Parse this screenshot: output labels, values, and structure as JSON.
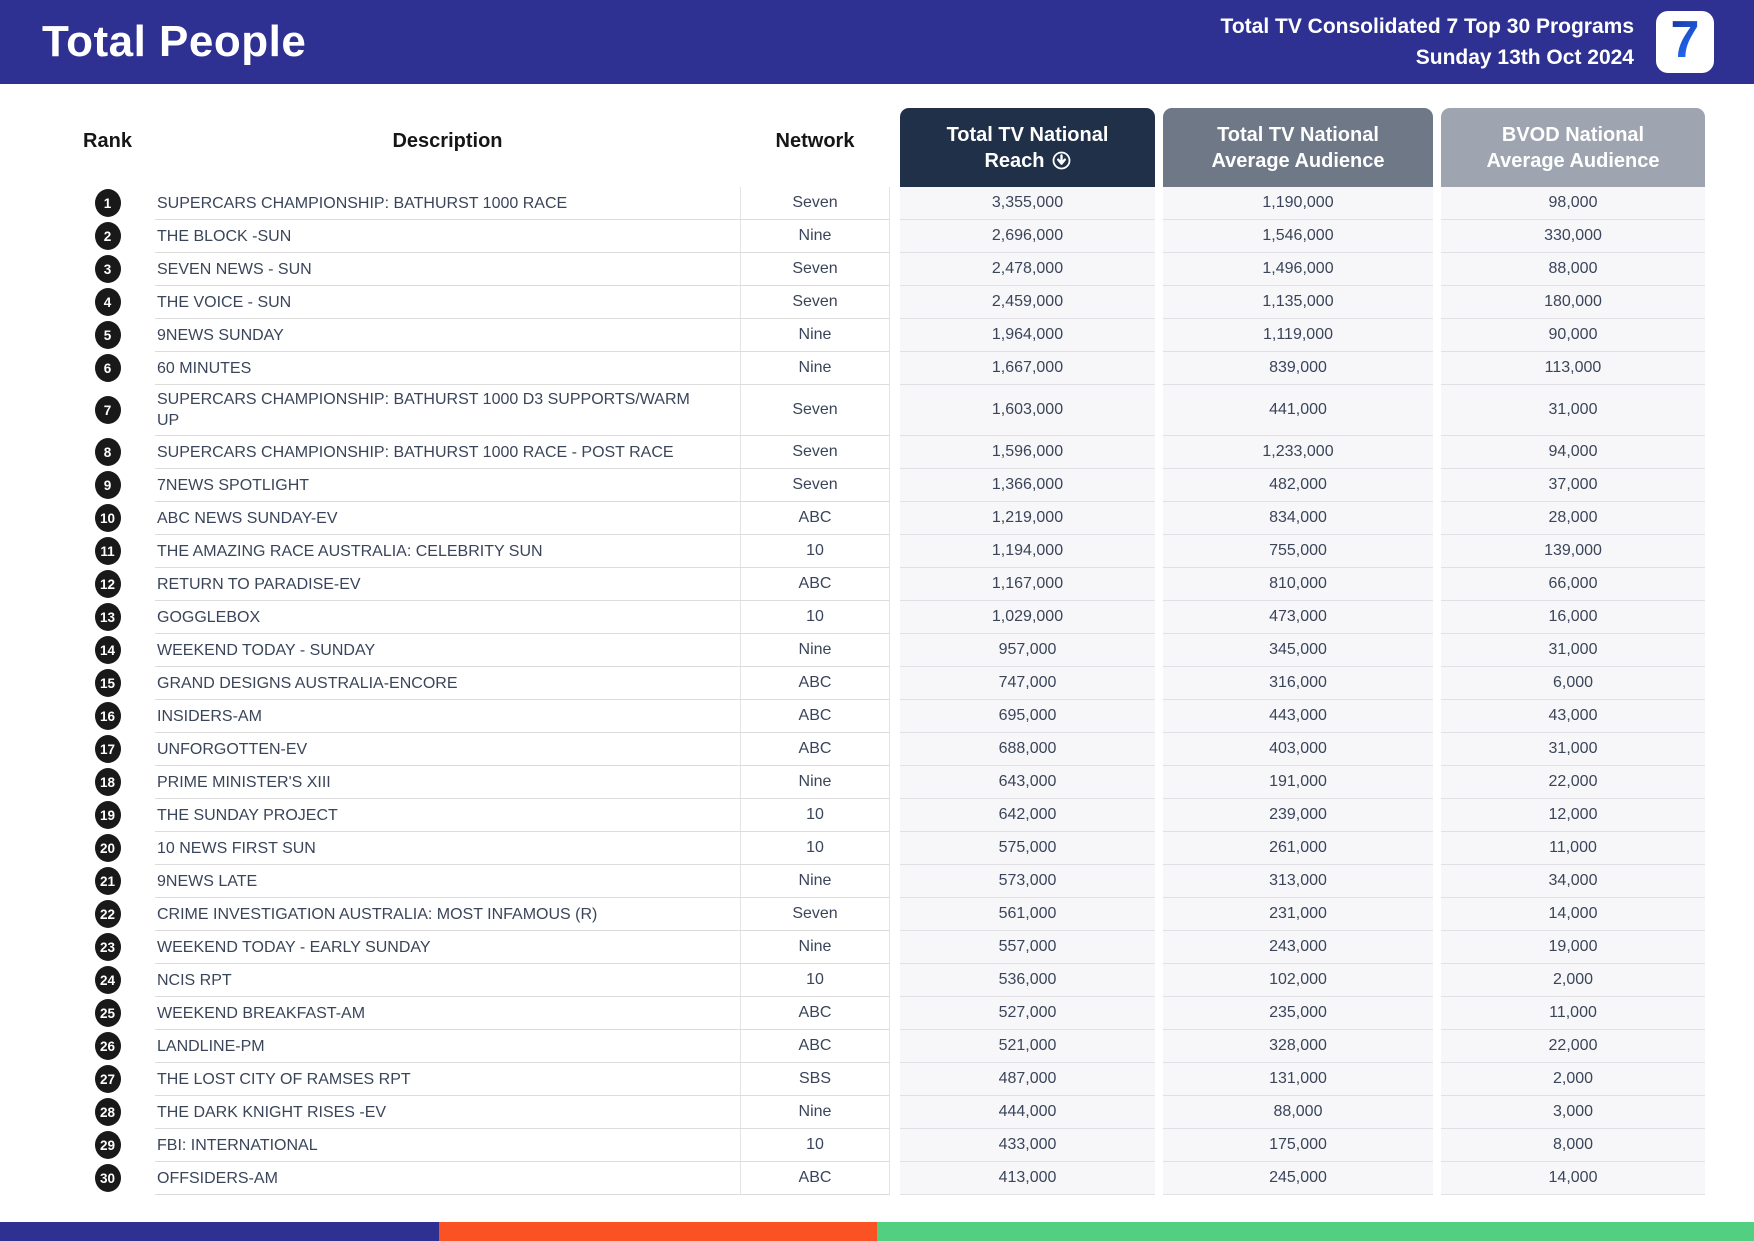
{
  "header": {
    "title": "Total People",
    "subtitle_line1": "Total TV Consolidated 7 Top 30 Programs",
    "subtitle_line2": "Sunday 13th Oct 2024",
    "logo_text": "7"
  },
  "table": {
    "columns": {
      "rank": "Rank",
      "description": "Description",
      "network": "Network",
      "reach_line1": "Total TV National",
      "reach_line2": "Reach",
      "avg_line1": "Total TV National",
      "avg_line2": "Average Audience",
      "bvod_line1": "BVOD National",
      "bvod_line2": "Average Audience"
    },
    "sort_icon": "circled-down-arrow",
    "rows": [
      {
        "rank": "1",
        "description": "SUPERCARS CHAMPIONSHIP: BATHURST 1000 RACE",
        "network": "Seven",
        "reach": "3,355,000",
        "avg": "1,190,000",
        "bvod": "98,000"
      },
      {
        "rank": "2",
        "description": "THE BLOCK -SUN",
        "network": "Nine",
        "reach": "2,696,000",
        "avg": "1,546,000",
        "bvod": "330,000"
      },
      {
        "rank": "3",
        "description": "SEVEN NEWS - SUN",
        "network": "Seven",
        "reach": "2,478,000",
        "avg": "1,496,000",
        "bvod": "88,000"
      },
      {
        "rank": "4",
        "description": "THE VOICE - SUN",
        "network": "Seven",
        "reach": "2,459,000",
        "avg": "1,135,000",
        "bvod": "180,000"
      },
      {
        "rank": "5",
        "description": "9NEWS SUNDAY",
        "network": "Nine",
        "reach": "1,964,000",
        "avg": "1,119,000",
        "bvod": "90,000"
      },
      {
        "rank": "6",
        "description": "60 MINUTES",
        "network": "Nine",
        "reach": "1,667,000",
        "avg": "839,000",
        "bvod": "113,000"
      },
      {
        "rank": "7",
        "description": "SUPERCARS CHAMPIONSHIP: BATHURST 1000 D3 SUPPORTS/WARM UP",
        "network": "Seven",
        "reach": "1,603,000",
        "avg": "441,000",
        "bvod": "31,000"
      },
      {
        "rank": "8",
        "description": "SUPERCARS CHAMPIONSHIP: BATHURST 1000 RACE - POST RACE",
        "network": "Seven",
        "reach": "1,596,000",
        "avg": "1,233,000",
        "bvod": "94,000"
      },
      {
        "rank": "9",
        "description": "7NEWS SPOTLIGHT",
        "network": "Seven",
        "reach": "1,366,000",
        "avg": "482,000",
        "bvod": "37,000"
      },
      {
        "rank": "10",
        "description": "ABC NEWS SUNDAY-EV",
        "network": "ABC",
        "reach": "1,219,000",
        "avg": "834,000",
        "bvod": "28,000"
      },
      {
        "rank": "11",
        "description": "THE AMAZING RACE AUSTRALIA: CELEBRITY SUN",
        "network": "10",
        "reach": "1,194,000",
        "avg": "755,000",
        "bvod": "139,000"
      },
      {
        "rank": "12",
        "description": "RETURN TO PARADISE-EV",
        "network": "ABC",
        "reach": "1,167,000",
        "avg": "810,000",
        "bvod": "66,000"
      },
      {
        "rank": "13",
        "description": "GOGGLEBOX",
        "network": "10",
        "reach": "1,029,000",
        "avg": "473,000",
        "bvod": "16,000"
      },
      {
        "rank": "14",
        "description": "WEEKEND TODAY - SUNDAY",
        "network": "Nine",
        "reach": "957,000",
        "avg": "345,000",
        "bvod": "31,000"
      },
      {
        "rank": "15",
        "description": "GRAND DESIGNS AUSTRALIA-ENCORE",
        "network": "ABC",
        "reach": "747,000",
        "avg": "316,000",
        "bvod": "6,000"
      },
      {
        "rank": "16",
        "description": "INSIDERS-AM",
        "network": "ABC",
        "reach": "695,000",
        "avg": "443,000",
        "bvod": "43,000"
      },
      {
        "rank": "17",
        "description": "UNFORGOTTEN-EV",
        "network": "ABC",
        "reach": "688,000",
        "avg": "403,000",
        "bvod": "31,000"
      },
      {
        "rank": "18",
        "description": "PRIME MINISTER'S XIII",
        "network": "Nine",
        "reach": "643,000",
        "avg": "191,000",
        "bvod": "22,000"
      },
      {
        "rank": "19",
        "description": "THE SUNDAY PROJECT",
        "network": "10",
        "reach": "642,000",
        "avg": "239,000",
        "bvod": "12,000"
      },
      {
        "rank": "20",
        "description": "10 NEWS FIRST SUN",
        "network": "10",
        "reach": "575,000",
        "avg": "261,000",
        "bvod": "11,000"
      },
      {
        "rank": "21",
        "description": "9NEWS LATE",
        "network": "Nine",
        "reach": "573,000",
        "avg": "313,000",
        "bvod": "34,000"
      },
      {
        "rank": "22",
        "description": "CRIME INVESTIGATION AUSTRALIA: MOST INFAMOUS (R)",
        "network": "Seven",
        "reach": "561,000",
        "avg": "231,000",
        "bvod": "14,000"
      },
      {
        "rank": "23",
        "description": "WEEKEND TODAY - EARLY SUNDAY",
        "network": "Nine",
        "reach": "557,000",
        "avg": "243,000",
        "bvod": "19,000"
      },
      {
        "rank": "24",
        "description": "NCIS RPT",
        "network": "10",
        "reach": "536,000",
        "avg": "102,000",
        "bvod": "2,000"
      },
      {
        "rank": "25",
        "description": "WEEKEND BREAKFAST-AM",
        "network": "ABC",
        "reach": "527,000",
        "avg": "235,000",
        "bvod": "11,000"
      },
      {
        "rank": "26",
        "description": "LANDLINE-PM",
        "network": "ABC",
        "reach": "521,000",
        "avg": "328,000",
        "bvod": "22,000"
      },
      {
        "rank": "27",
        "description": "THE LOST CITY OF RAMSES RPT",
        "network": "SBS",
        "reach": "487,000",
        "avg": "131,000",
        "bvod": "2,000"
      },
      {
        "rank": "28",
        "description": "THE DARK KNIGHT RISES -EV",
        "network": "Nine",
        "reach": "444,000",
        "avg": "88,000",
        "bvod": "3,000"
      },
      {
        "rank": "29",
        "description": "FBI: INTERNATIONAL",
        "network": "10",
        "reach": "433,000",
        "avg": "175,000",
        "bvod": "8,000"
      },
      {
        "rank": "30",
        "description": "OFFSIDERS-AM",
        "network": "ABC",
        "reach": "413,000",
        "avg": "245,000",
        "bvod": "14,000"
      }
    ]
  },
  "colors": {
    "banner_blue": "#2E3192",
    "reach_header": "#203049",
    "avg_header": "#6E7887",
    "bvod_header": "#9EA5B0",
    "footer_blue": "#2E3192",
    "footer_orange": "#FB5224",
    "footer_green": "#52CF80"
  },
  "footer": {
    "segments": [
      "blue",
      "orange",
      "green"
    ]
  }
}
